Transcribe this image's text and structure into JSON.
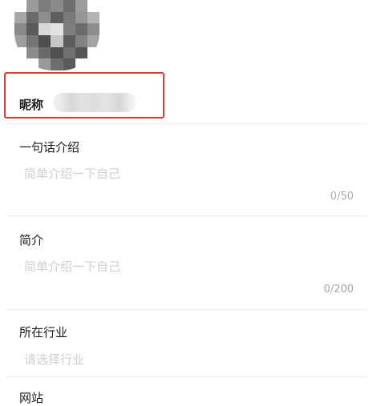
{
  "profile": {
    "nickname_label": "昵称",
    "nickname_value_obscured": true
  },
  "fields": {
    "intro": {
      "label": "一句话介绍",
      "placeholder": "简单介绍一下自己",
      "counter": "0/50"
    },
    "bio": {
      "label": "简介",
      "placeholder": "简单介绍一下自己",
      "counter": "0/200"
    },
    "industry": {
      "label": "所在行业",
      "placeholder": "请选择行业"
    },
    "website": {
      "label": "网站"
    }
  },
  "colors": {
    "highlight": "#e53935",
    "placeholder": "#cfcfcf",
    "counter": "#a8a8a8"
  },
  "icons": {
    "avatar": "avatar-pixelated"
  }
}
